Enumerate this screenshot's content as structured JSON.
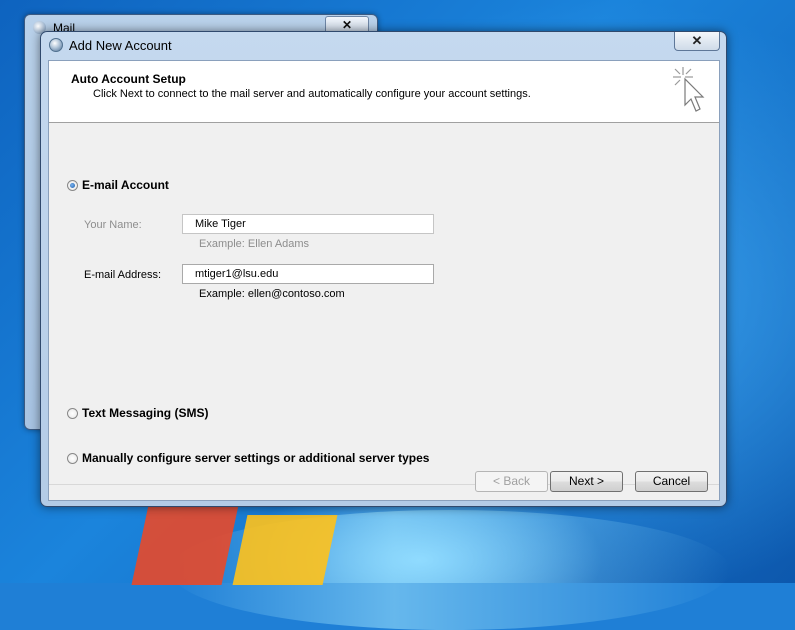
{
  "mail_window": {
    "title": "Mail",
    "close_label": "✕"
  },
  "dialog": {
    "title": "Add New Account",
    "close_label": "✕",
    "header": {
      "title": "Auto Account Setup",
      "subtitle": "Click Next to connect to the mail server and automatically configure your account settings."
    },
    "options": {
      "email_account": {
        "label": "E-mail Account",
        "selected": true
      },
      "sms": {
        "label": "Text Messaging (SMS)",
        "selected": false
      },
      "manual": {
        "label": "Manually configure server settings or additional server types",
        "selected": false
      }
    },
    "fields": {
      "name": {
        "label": "Your Name:",
        "value": "Mike    Tiger",
        "example": "Example: Ellen Adams"
      },
      "email": {
        "label": "E-mail Address:",
        "value": "mtiger1@lsu.edu",
        "example": "Example: ellen@contoso.com"
      }
    },
    "buttons": {
      "back": "< Back",
      "next": "Next >",
      "cancel": "Cancel"
    }
  },
  "icons": {
    "wizard": "cursor-sparkle-icon",
    "app": "outlook-icon"
  }
}
